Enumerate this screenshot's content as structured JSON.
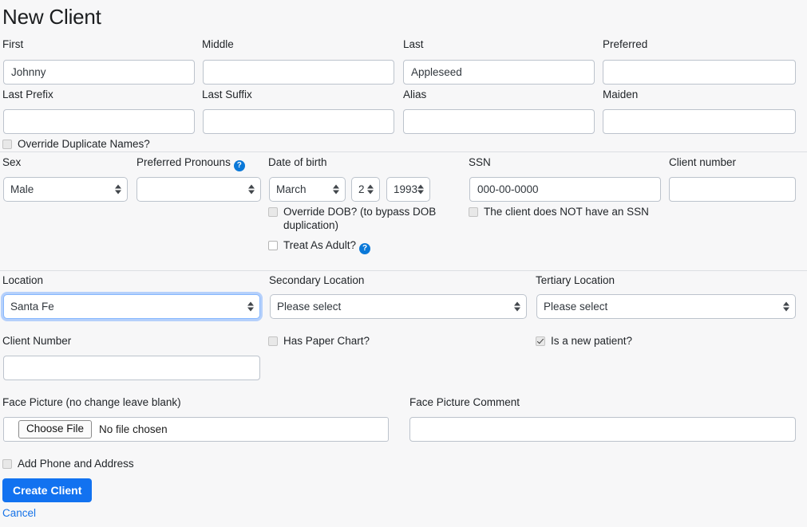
{
  "page": {
    "title": "New Client"
  },
  "colors": {
    "primary": "#1272f0",
    "link": "#1673e8",
    "help_badge": "#0a78d8",
    "focus_ring": "#86b7fe",
    "background": "#f7f7f8",
    "input_border": "#bcc3cc"
  },
  "name_section": {
    "first": {
      "label": "First",
      "value": "Johnny"
    },
    "middle": {
      "label": "Middle",
      "value": ""
    },
    "last": {
      "label": "Last",
      "value": "Appleseed"
    },
    "preferred": {
      "label": "Preferred",
      "value": ""
    },
    "last_prefix": {
      "label": "Last Prefix",
      "value": ""
    },
    "last_suffix": {
      "label": "Last Suffix",
      "value": ""
    },
    "alias": {
      "label": "Alias",
      "value": ""
    },
    "maiden": {
      "label": "Maiden",
      "value": ""
    },
    "override_duplicate_names": {
      "label": "Override Duplicate Names?",
      "checked": false,
      "disabled": true
    }
  },
  "demographics_section": {
    "sex": {
      "label": "Sex",
      "value": "Male"
    },
    "preferred_pronouns": {
      "label": "Preferred Pronouns",
      "value": "",
      "help": "?"
    },
    "date_of_birth": {
      "label": "Date of birth",
      "month": "March",
      "day": "2",
      "year": "1993"
    },
    "override_dob": {
      "label": "Override DOB? (to bypass DOB duplication)",
      "checked": false,
      "disabled": true
    },
    "treat_as_adult": {
      "label": "Treat As Adult?",
      "checked": false,
      "disabled": false,
      "help": "?"
    },
    "ssn": {
      "label": "SSN",
      "value": "",
      "placeholder": "000-00-0000"
    },
    "no_ssn": {
      "label": "The client does NOT have an SSN",
      "checked": false,
      "disabled": true
    },
    "client_number_top": {
      "label": "Client number",
      "value": ""
    }
  },
  "location_section": {
    "location": {
      "label": "Location",
      "value": "Santa Fe",
      "focused": true
    },
    "secondary_location": {
      "label": "Secondary Location",
      "value": "Please select"
    },
    "tertiary_location": {
      "label": "Tertiary Location",
      "value": "Please select"
    },
    "client_number": {
      "label": "Client Number",
      "value": ""
    },
    "has_paper_chart": {
      "label": "Has Paper Chart?",
      "checked": false,
      "disabled": true
    },
    "is_new_patient": {
      "label": "Is a new patient?",
      "checked": true,
      "disabled": true
    }
  },
  "picture_section": {
    "face_picture": {
      "label": "Face Picture (no change leave blank)",
      "button_label": "Choose File",
      "status": "No file chosen"
    },
    "face_picture_comment": {
      "label": "Face Picture Comment",
      "value": ""
    }
  },
  "footer": {
    "add_phone_and_address": {
      "label": "Add Phone and Address",
      "checked": false,
      "disabled": true
    },
    "create_button": "Create Client",
    "cancel_link": "Cancel"
  }
}
